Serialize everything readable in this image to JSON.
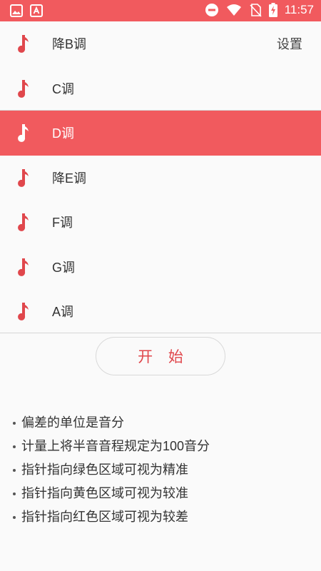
{
  "status_bar": {
    "time": "11:57",
    "left_icons": [
      "image-icon",
      "app-notification-icon"
    ],
    "right_icons": [
      "do-not-disturb-icon",
      "wifi-icon",
      "no-sim-icon",
      "battery-charging-icon"
    ]
  },
  "colors": {
    "accent": "#f15a5e",
    "start_text": "#e0474c",
    "background": "#fafafa"
  },
  "key_list": {
    "items": [
      {
        "label": "降B调",
        "icon": "music-note-icon"
      },
      {
        "label": "C调",
        "icon": "music-note-icon"
      },
      {
        "label": "D调",
        "icon": "music-note-icon",
        "selected": true
      },
      {
        "label": "降E调",
        "icon": "music-note-icon"
      },
      {
        "label": "F调",
        "icon": "music-note-icon"
      },
      {
        "label": "G调",
        "icon": "music-note-icon"
      },
      {
        "label": "A调",
        "icon": "music-note-icon"
      }
    ],
    "settings_label": "设置"
  },
  "start_button": {
    "label": "开 始"
  },
  "notes": [
    "偏差的单位是音分",
    "计量上将半音音程规定为100音分",
    "指针指向绿色区域可视为精准",
    "指针指向黄色区域可视为较准",
    "指针指向红色区域可视为较差"
  ]
}
